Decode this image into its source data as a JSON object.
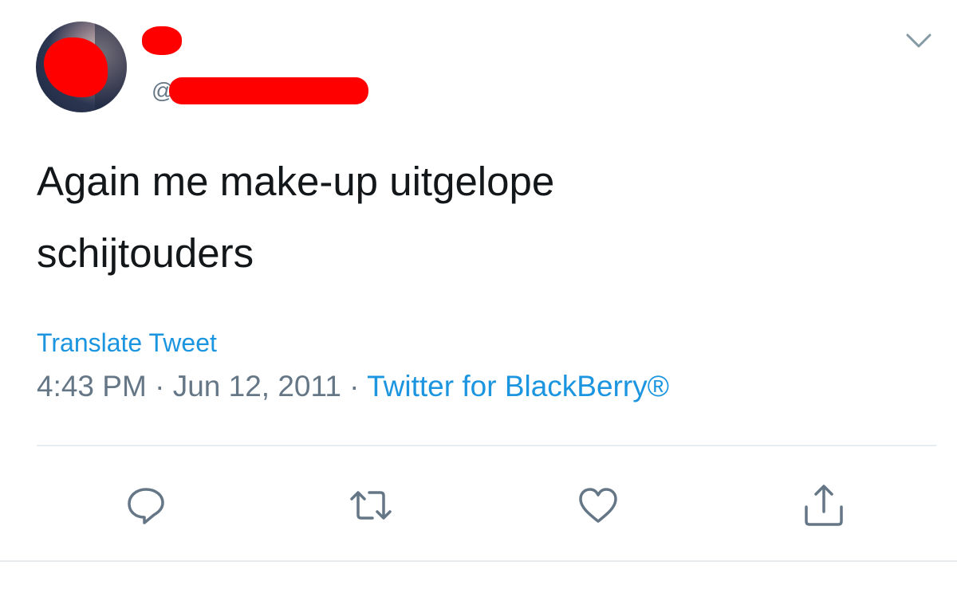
{
  "author": {
    "handle_prefix": "@"
  },
  "tweet": {
    "text_line_1": "Again me make-up uitgelope",
    "text_line_2": "schijtouders",
    "translate_label": "Translate Tweet",
    "time": "4:43 PM",
    "separator": " · ",
    "date": "Jun 12, 2011",
    "source": "Twitter for BlackBerry®"
  },
  "icons": {
    "caret": "chevron-down-icon",
    "reply": "reply-icon",
    "retweet": "retweet-icon",
    "like": "heart-icon",
    "share": "share-icon"
  },
  "colors": {
    "text": "#14171a",
    "secondary": "#657786",
    "link": "#1b95e0",
    "redaction": "#ff0000",
    "divider": "#e6ecf0"
  }
}
